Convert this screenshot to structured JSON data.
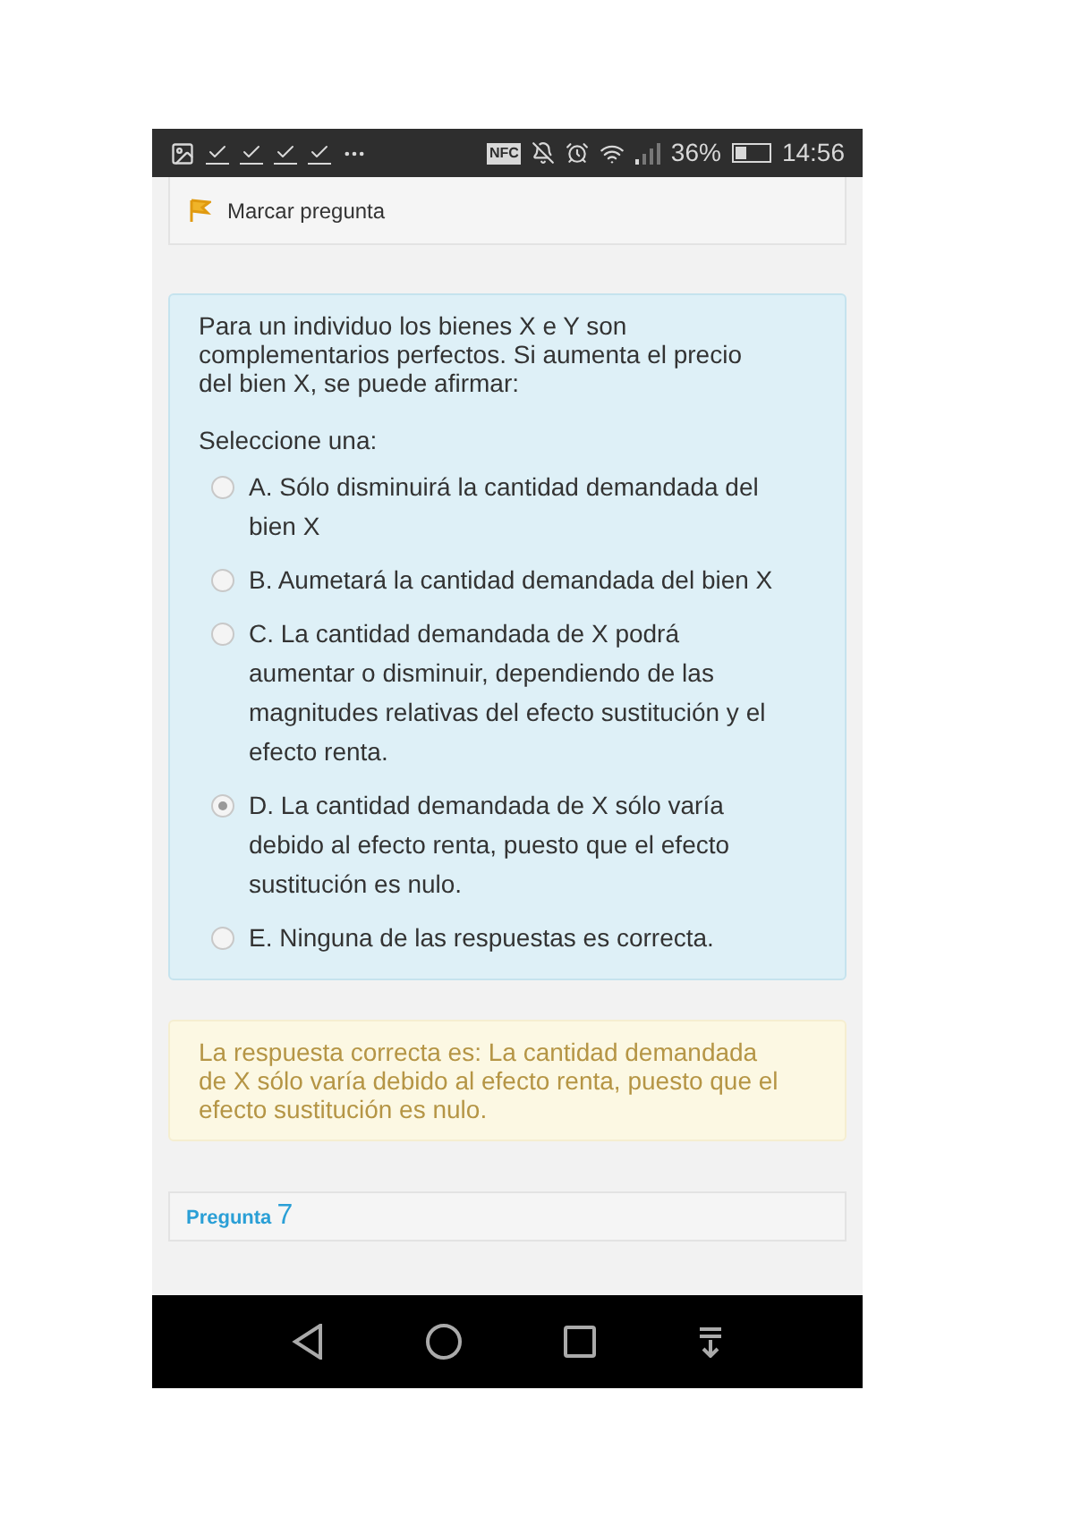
{
  "status_bar": {
    "nfc": "NFC",
    "battery": "36%",
    "time": "14:56"
  },
  "flag": {
    "label": "Marcar pregunta"
  },
  "question": {
    "text": "Para un individuo los bienes X e Y son complementarios perfectos. Si aumenta el precio del bien X, se puede afirmar:",
    "prompt": "Seleccione una:",
    "options": [
      {
        "label": "A. Sólo disminuirá la cantidad demandada del bien X",
        "selected": false
      },
      {
        "label": "B. Aumetará la cantidad demandada del bien X",
        "selected": false
      },
      {
        "label": "C. La cantidad demandada de X podrá aumentar o disminuir, dependiendo de las magnitudes relativas del efecto sustitución y el efecto renta.",
        "selected": false
      },
      {
        "label": "D. La cantidad demandada de X sólo varía debido al efecto renta, puesto que el efecto sustitución es nulo.",
        "selected": true
      },
      {
        "label": "E. Ninguna de las respuestas es correcta.",
        "selected": false
      }
    ]
  },
  "feedback": {
    "text": "La respuesta correcta es: La cantidad demandada de X sólo varía debido al efecto renta, puesto que el efecto sustitución es nulo."
  },
  "next_question": {
    "label": "Pregunta",
    "number": "7"
  }
}
